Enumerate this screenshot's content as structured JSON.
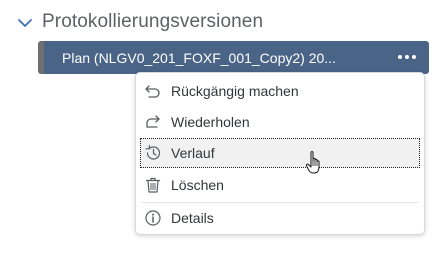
{
  "section": {
    "title": "Protokollierungsversionen"
  },
  "version": {
    "label": "Plan (NLGV0_201_FOXF_001_Copy2) 20..."
  },
  "menu": {
    "items": [
      {
        "label": "Rückgängig machen",
        "icon": "undo-icon"
      },
      {
        "label": "Wiederholen",
        "icon": "redo-icon"
      },
      {
        "label": "Verlauf",
        "icon": "history-icon",
        "hovered": true
      },
      {
        "label": "Löschen",
        "icon": "trash-icon"
      },
      {
        "label": "Details",
        "icon": "info-icon"
      }
    ]
  },
  "colors": {
    "version_bg": "#4a6488",
    "version_marker": "#6f6f6f",
    "hover_bg": "#f1f1f1"
  }
}
